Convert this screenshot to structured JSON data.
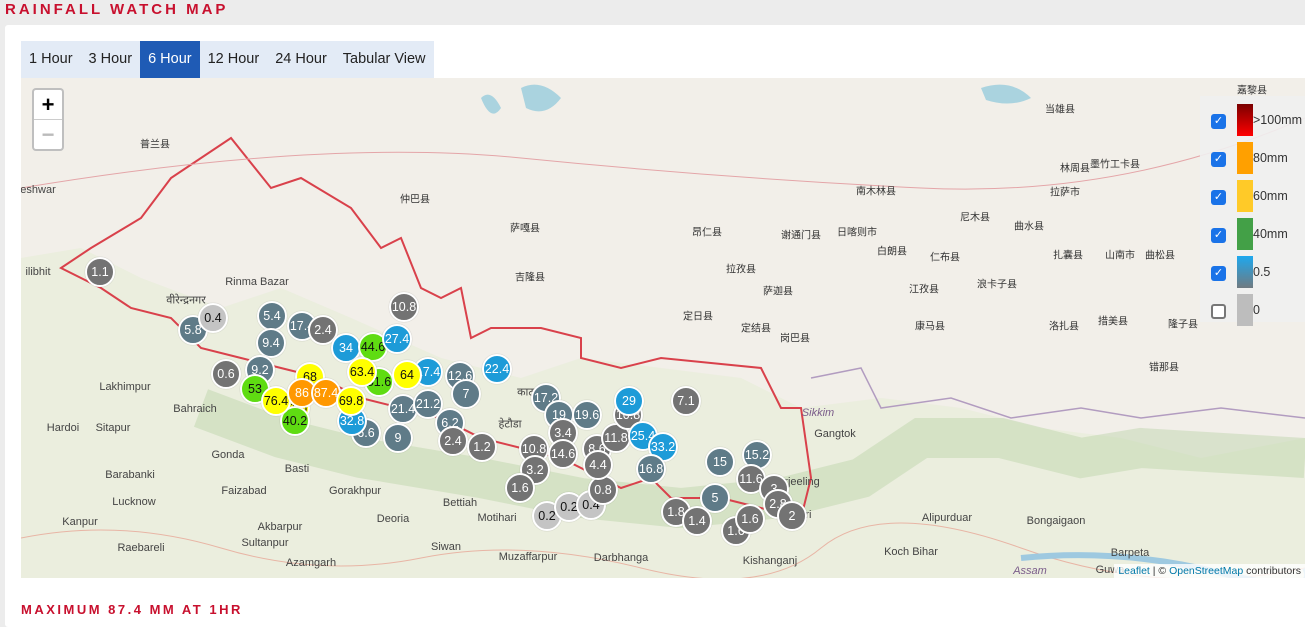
{
  "title": "RAINFALL WATCH MAP",
  "tabs": [
    {
      "label": "1 Hour",
      "active": false
    },
    {
      "label": "3 Hour",
      "active": false
    },
    {
      "label": "6 Hour",
      "active": true
    },
    {
      "label": "12 Hour",
      "active": false
    },
    {
      "label": "24 Hour",
      "active": false
    },
    {
      "label": "Tabular View",
      "active": false
    }
  ],
  "zoom": {
    "in": "+",
    "out": "−"
  },
  "legend": [
    {
      "label": ">100mm",
      "checked": true,
      "color": "#d40000"
    },
    {
      "label": "80mm",
      "checked": true,
      "color": "#ffa000"
    },
    {
      "label": "60mm",
      "checked": true,
      "color": "#ffca28"
    },
    {
      "label": "40mm",
      "checked": true,
      "color": "#43a047"
    },
    {
      "label": "0.5",
      "checked": true,
      "color": "#29a3e0"
    },
    {
      "label": "0",
      "checked": false,
      "color": "#bdbdbd"
    }
  ],
  "marker_colors": {
    "slate": "#5f7b88",
    "gray": "#737373",
    "light": "#c4c4c4",
    "blue": "#1d9bd8",
    "green": "#5fdc12",
    "yellow": "#ffff00",
    "orange": "#ff9800"
  },
  "markers": [
    {
      "value": "1.1",
      "cls": "gray"
    },
    {
      "value": "5.8",
      "cls": "slate"
    },
    {
      "value": "0.4",
      "cls": "light"
    },
    {
      "value": "5.4",
      "cls": "slate"
    },
    {
      "value": "9.4",
      "cls": "slate"
    },
    {
      "value": "17.4",
      "cls": "slate"
    },
    {
      "value": "2.4",
      "cls": "gray"
    },
    {
      "value": "0.6",
      "cls": "gray"
    },
    {
      "value": "9.2",
      "cls": "slate"
    },
    {
      "value": "53",
      "cls": "green"
    },
    {
      "value": "68",
      "cls": "yellow"
    },
    {
      "value": "71.6",
      "cls": "yellow"
    },
    {
      "value": "40.2",
      "cls": "green"
    },
    {
      "value": "76.4",
      "cls": "yellow"
    },
    {
      "value": "86",
      "cls": "orange"
    },
    {
      "value": "87.4",
      "cls": "orange"
    },
    {
      "value": "6.6",
      "cls": "slate"
    },
    {
      "value": "32.8",
      "cls": "blue"
    },
    {
      "value": "69.8",
      "cls": "yellow"
    },
    {
      "value": "34",
      "cls": "blue"
    },
    {
      "value": "44.6",
      "cls": "green"
    },
    {
      "value": "27.4",
      "cls": "blue"
    },
    {
      "value": "10.8",
      "cls": "gray"
    },
    {
      "value": "51.6",
      "cls": "green"
    },
    {
      "value": "63.4",
      "cls": "yellow"
    },
    {
      "value": "17.4",
      "cls": "blue"
    },
    {
      "value": "64",
      "cls": "yellow"
    },
    {
      "value": "21.4",
      "cls": "slate"
    },
    {
      "value": "21.2",
      "cls": "slate"
    },
    {
      "value": "9",
      "cls": "slate"
    },
    {
      "value": "6.2",
      "cls": "slate"
    },
    {
      "value": "2.4",
      "cls": "gray"
    },
    {
      "value": "12.6",
      "cls": "slate"
    },
    {
      "value": "7",
      "cls": "slate"
    },
    {
      "value": "22.4",
      "cls": "blue"
    },
    {
      "value": "1.2",
      "cls": "gray"
    },
    {
      "value": "17.2",
      "cls": "slate"
    },
    {
      "value": "19",
      "cls": "slate"
    },
    {
      "value": "19.6",
      "cls": "slate"
    },
    {
      "value": "3.4",
      "cls": "gray"
    },
    {
      "value": "10.8",
      "cls": "gray"
    },
    {
      "value": "14.6",
      "cls": "gray"
    },
    {
      "value": "3.2",
      "cls": "gray"
    },
    {
      "value": "1.6",
      "cls": "gray"
    },
    {
      "value": "0.2",
      "cls": "light"
    },
    {
      "value": "0.2",
      "cls": "light"
    },
    {
      "value": "0.4",
      "cls": "light"
    },
    {
      "value": "0.8",
      "cls": "gray"
    },
    {
      "value": "8.6",
      "cls": "gray"
    },
    {
      "value": "4.4",
      "cls": "gray"
    },
    {
      "value": "11.8",
      "cls": "gray"
    },
    {
      "value": "10.8",
      "cls": "gray"
    },
    {
      "value": "29",
      "cls": "blue"
    },
    {
      "value": "25.4",
      "cls": "blue"
    },
    {
      "value": "33.2",
      "cls": "blue"
    },
    {
      "value": "16.8",
      "cls": "slate"
    },
    {
      "value": "7.1",
      "cls": "gray"
    },
    {
      "value": "15",
      "cls": "slate"
    },
    {
      "value": "15.2",
      "cls": "slate"
    },
    {
      "value": "11.6",
      "cls": "gray"
    },
    {
      "value": "5",
      "cls": "slate"
    },
    {
      "value": "1.8",
      "cls": "gray"
    },
    {
      "value": "1.4",
      "cls": "gray"
    },
    {
      "value": "1.6",
      "cls": "gray"
    },
    {
      "value": "1.6",
      "cls": "gray"
    },
    {
      "value": "3",
      "cls": "gray"
    },
    {
      "value": "2.8",
      "cls": "gray"
    },
    {
      "value": "2",
      "cls": "gray"
    }
  ],
  "map_labels": [
    "普兰县",
    "eshwar",
    "仲巴县",
    "萨嘎县",
    "吉隆县",
    "昂仁县",
    "谢通门县",
    "日喀则市",
    "南木林县",
    "拉孜县",
    "萨迦县",
    "白朗县",
    "仁布县",
    "江孜县",
    "浪卡子县",
    "尼木县",
    "曲水县",
    "拉萨市",
    "林周县",
    "墨竹工卡县",
    "当雄县",
    "扎囊县",
    "山南市",
    "曲松县",
    "定日县",
    "定结县",
    "岗巴县",
    "康马县",
    "洛扎县",
    "措美县",
    "隆子县",
    "错那县",
    "嘉黎县",
    "Rinma Bazar",
    "Lakhimpur",
    "Bahraich",
    "Hardoi",
    "Sitapur",
    "Gonda",
    "Barabanki",
    "Lucknow",
    "Faizabad",
    "Basti",
    "Gorakhpur",
    "Kanpur",
    "Akbarpur",
    "Sultanpur",
    "Raebareli",
    "Azamgarh",
    "Deoria",
    "Bettiah",
    "Motihari",
    "Siwan",
    "Muzaffarpur",
    "Darbhanga",
    "Kishanganj",
    "Gangtok",
    "Sikkim",
    "Alipurduar",
    "Bongaigaon",
    "Koch Bihar",
    "Barpeta",
    "Assam",
    "Guwa",
    "ilibhit",
    "Darjeeling",
    "Siliguri",
    "काठमाडौं",
    "हेटौडा",
    "वीरेन्द्रनगर"
  ],
  "attribution": {
    "leaflet": "Leaflet",
    "sep": " | © ",
    "osm": "OpenStreetMap",
    "rest": " contributors"
  },
  "footer": "MAXIMUM 87.4 MM AT 1HR"
}
